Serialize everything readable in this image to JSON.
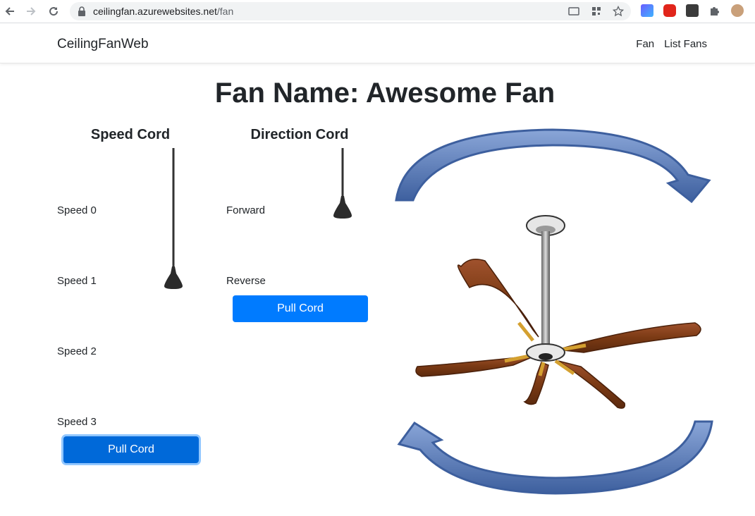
{
  "browser": {
    "url_host": "ceilingfan.azurewebsites.net",
    "url_path": "/fan",
    "icons": [
      "back-icon",
      "forward-icon",
      "reload-icon",
      "lock-icon",
      "cast-icon",
      "qr-icon",
      "star-icon",
      "extension-icon",
      "profile-icon"
    ]
  },
  "navbar": {
    "brand": "CeilingFanWeb",
    "links": [
      "Fan",
      "List Fans"
    ]
  },
  "page": {
    "title": "Fan Name: Awesome Fan"
  },
  "speed": {
    "heading": "Speed Cord",
    "levels": [
      "Speed 0",
      "Speed 1",
      "Speed 2",
      "Speed 3"
    ],
    "current_level": 1,
    "button": "Pull Cord"
  },
  "direction": {
    "heading": "Direction Cord",
    "options": [
      "Forward",
      "Reverse"
    ],
    "current": "Forward",
    "button": "Pull Cord"
  },
  "colors": {
    "primary": "#007bff",
    "arrow": "#5a7fc0",
    "wood": "#8b4513"
  }
}
